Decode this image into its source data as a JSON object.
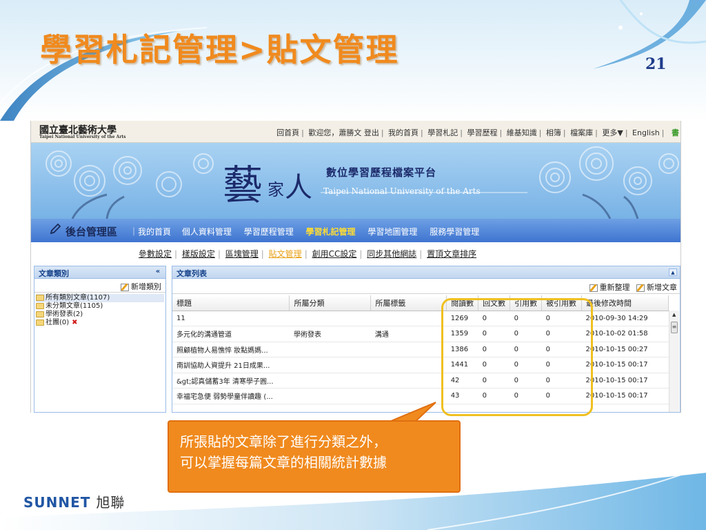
{
  "slide": {
    "title": "學習札記管理>貼文管理",
    "page_number": "21",
    "callout_line1": "所張貼的文章除了進行分類之外，",
    "callout_line2": "可以掌握每篇文章的相關統計數據",
    "footer_brand": "SUNNET",
    "footer_brand_cn": "旭聯"
  },
  "topbar": {
    "logo_cn": "國立臺北藝術大學",
    "logo_en": "Taipei National University of the Arts",
    "links": [
      "回首頁",
      "歡迎您，蕭勝文 登出",
      "我的首頁",
      "學習札記",
      "學習歷程",
      "維基知識",
      "相簿",
      "檔案庫",
      "更多▼",
      "English"
    ],
    "book_icon": "書"
  },
  "banner": {
    "art_char1": "藝",
    "art_char2": "家",
    "art_char3": "人",
    "platform_cn": "數位學習歷程檔案平台",
    "platform_en": "Taipei National University of the Arts"
  },
  "navbar": {
    "admin_label": "後台管理區",
    "items": [
      "｜我的首頁",
      "個人資料管理",
      "學習歷程管理",
      "學習札記管理",
      "學習地圖管理",
      "服務學習管理"
    ]
  },
  "subnav": {
    "items": [
      "參數設定",
      "樣版設定",
      "區塊管理",
      "貼文管理",
      "創用CC設定",
      "同步其他網誌",
      "置頂文章排序"
    ]
  },
  "left_panel": {
    "title": "文章類別",
    "collapse_icon": "«",
    "add_label": "新增類別",
    "tree": [
      {
        "name": "所有類別文章",
        "count": "(1107)"
      },
      {
        "name": "未分類文章",
        "count": "(1105)"
      },
      {
        "name": "學術發表",
        "count": "(2)"
      },
      {
        "name": "社團",
        "count": "(0)"
      }
    ],
    "delete_icon": "✖"
  },
  "right_panel": {
    "title": "文章列表",
    "refresh_label": "重新整理",
    "add_label": "新增文章",
    "columns": [
      "標題",
      "所屬分類",
      "所屬標籤",
      "閱讀數",
      "回文數",
      "引用數",
      "被引用數",
      "最後修改時間"
    ],
    "rows": [
      [
        "11",
        "",
        "",
        "1269",
        "0",
        "0",
        "0",
        "2010-09-30 14:29"
      ],
      [
        "多元化的溝通管道",
        "學術發表",
        "溝通",
        "1359",
        "0",
        "0",
        "0",
        "2010-10-02 01:58"
      ],
      [
        "照顧植物人易憔悴 妝點媽媽...",
        "",
        "",
        "1386",
        "0",
        "0",
        "0",
        "2010-10-15 00:27"
      ],
      [
        "南訓協助人資提升 21日成果...",
        "",
        "",
        "1441",
        "0",
        "0",
        "0",
        "2010-10-15 00:17"
      ],
      [
        "&gt;認真儲蓄3年 清寒學子圓...",
        "",
        "",
        "42",
        "0",
        "0",
        "0",
        "2010-10-15 00:17"
      ],
      [
        "幸福宅急便 弱勢學童伴讀趣 (...",
        "",
        "",
        "43",
        "0",
        "0",
        "0",
        "2010-10-15 00:17"
      ]
    ]
  },
  "colors": {
    "title_orange": "#f08a1e",
    "callout_orange": "#f08a1e",
    "highlight_yellow": "#f0c020",
    "nav_blue": "#3f74d0",
    "active_nav": "#ffdd33"
  }
}
